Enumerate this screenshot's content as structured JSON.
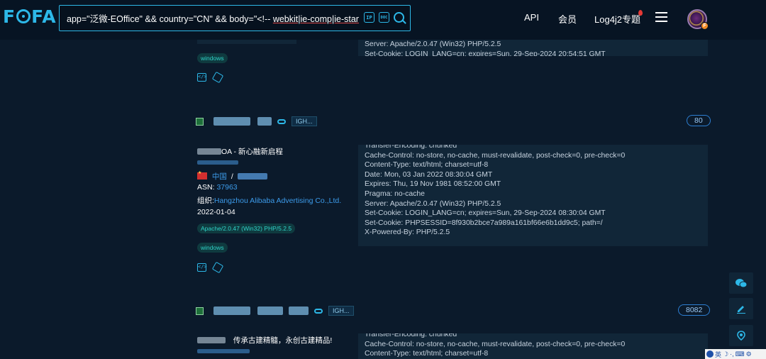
{
  "header": {
    "logo": "FOFA",
    "logo_parts": {
      "f1": "F",
      "f2": "FA"
    },
    "search": {
      "query_before": "app=\"泛微-EOffice\" && country=\"CN\" && body=\"<!-- ",
      "query_underlined": "webkit|ie-comp|ie-stand",
      "query_after": " -->\"",
      "tool_ip": "IP",
      "tool_doc": "DOC"
    },
    "nav": {
      "api": "API",
      "member": "会员",
      "log4j2": "Log4j2专题"
    },
    "avatar_badge": "F"
  },
  "card1": {
    "banner_lines": [
      "Server: Apache/2.0.47 (Win32) PHP/5.2.5",
      "Set-Cookie: LOGIN_LANG=cn; expires=Sun, 29-Sep-2024 20:54:51 GMT"
    ],
    "tags": [
      "windows"
    ]
  },
  "card2": {
    "host_tag": "IGH...",
    "port": "80",
    "title": "OA - 新心融新启程",
    "country": "中国",
    "asn_label": "ASN:",
    "asn": "37963",
    "org_label": "组织:",
    "org": "Hangzhou Alibaba Advertising Co.,Ltd.",
    "date": "2022-01-04",
    "tags": [
      "Apache/2.0.47 (Win32) PHP/5.2.5",
      "windows"
    ],
    "banner_lines": [
      "Transfer-Encoding: chunked",
      "Cache-Control: no-store, no-cache, must-revalidate, post-check=0, pre-check=0",
      "Content-Type: text/html; charset=utf-8",
      "Date: Mon, 03 Jan 2022 08:30:04 GMT",
      "Expires: Thu, 19 Nov 1981 08:52:00 GMT",
      "Pragma: no-cache",
      "Server: Apache/2.0.47 (Win32) PHP/5.2.5",
      "Set-Cookie: LOGIN_LANG=cn; expires=Sun, 29-Sep-2024 08:30:04 GMT",
      "Set-Cookie: PHPSESSID=8f930b2bce7a989a161bf66e6b1dd9c5; path=/",
      "X-Powered-By: PHP/5.2.5"
    ]
  },
  "card3": {
    "host_tag": "IGH...",
    "port": "8082",
    "title": "传承古建精髓，永创古建精品!",
    "banner_lines": [
      "Transfer-Encoding: chunked",
      "Cache-Control: no-store, no-cache, must-revalidate, post-check=0, pre-check=0",
      "Content-Type: text/html; charset=utf-8"
    ]
  },
  "ime": {
    "label": "英"
  },
  "colors": {
    "accent": "#2db8e8",
    "background": "#0b1a2b",
    "header_bg": "#071423",
    "tag_text": "#2fd3c8",
    "link": "#3c9bea"
  }
}
